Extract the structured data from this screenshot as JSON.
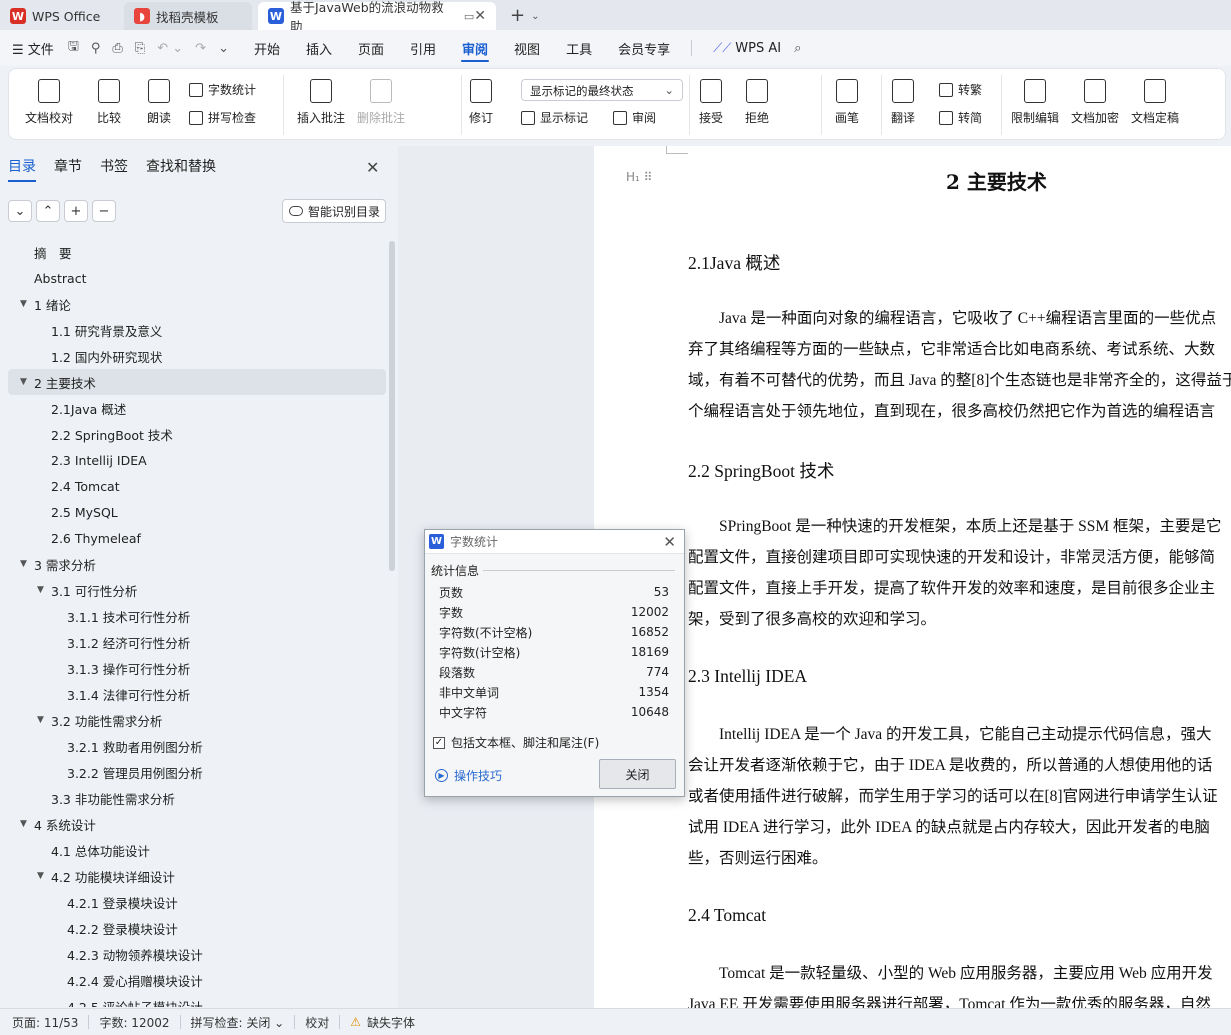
{
  "tabs": {
    "wps": "WPS Office",
    "template": "找稻壳模板",
    "doc": "基于JavaWeb的流浪动物救助"
  },
  "menu": {
    "file": "文件",
    "tabs": [
      "开始",
      "插入",
      "页面",
      "引用",
      "审阅",
      "视图",
      "工具",
      "会员专享"
    ],
    "active": "审阅",
    "ai": "WPS AI"
  },
  "ribbon": {
    "doc_check": "文档校对",
    "compare": "比较",
    "read": "朗读",
    "word_count": "字数统计",
    "spell_check": "拼写检查",
    "insert_comment": "插入批注",
    "delete_comment": "删除批注",
    "revise": "修订",
    "markup_state": "显示标记的最终状态",
    "show_markup": "显示标记",
    "review_pane": "审阅",
    "accept": "接受",
    "reject": "拒绝",
    "pen": "画笔",
    "translate": "翻译",
    "to_traditional": "转繁",
    "to_simplified": "转简",
    "restrict_edit": "限制编辑",
    "encrypt": "文档加密",
    "finalize": "文档定稿"
  },
  "nav": {
    "tabs": [
      "目录",
      "章节",
      "书签",
      "查找和替换"
    ],
    "smart_toc": "智能识别目录",
    "toc": [
      {
        "label": "摘　要",
        "level": 0,
        "caret": false
      },
      {
        "label": "Abstract",
        "level": 0,
        "caret": false
      },
      {
        "label": "1  绪论",
        "level": 0,
        "caret": true
      },
      {
        "label": "1.1 研究背景及意义",
        "level": 1,
        "caret": false
      },
      {
        "label": "1.2 国内外研究现状",
        "level": 1,
        "caret": false
      },
      {
        "label": "2  主要技术",
        "level": 0,
        "caret": true,
        "selected": true
      },
      {
        "label": "2.1Java 概述",
        "level": 1,
        "caret": false
      },
      {
        "label": "2.2 SpringBoot 技术",
        "level": 1,
        "caret": false
      },
      {
        "label": "2.3 Intellij IDEA",
        "level": 1,
        "caret": false
      },
      {
        "label": "2.4 Tomcat",
        "level": 1,
        "caret": false
      },
      {
        "label": "2.5 MySQL",
        "level": 1,
        "caret": false
      },
      {
        "label": "2.6 Thymeleaf",
        "level": 1,
        "caret": false
      },
      {
        "label": "3  需求分析",
        "level": 0,
        "caret": true
      },
      {
        "label": "3.1 可行性分析",
        "level": 1,
        "caret": true
      },
      {
        "label": "3.1.1  技术可行性分析",
        "level": 2,
        "caret": false
      },
      {
        "label": "3.1.2  经济可行性分析",
        "level": 2,
        "caret": false
      },
      {
        "label": "3.1.3  操作可行性分析",
        "level": 2,
        "caret": false
      },
      {
        "label": "3.1.4  法律可行性分析",
        "level": 2,
        "caret": false
      },
      {
        "label": "3.2  功能性需求分析",
        "level": 1,
        "caret": true
      },
      {
        "label": "3.2.1 救助者用例图分析",
        "level": 2,
        "caret": false
      },
      {
        "label": "3.2.2  管理员用例图分析",
        "level": 2,
        "caret": false
      },
      {
        "label": "3.3  非功能性需求分析",
        "level": 1,
        "caret": false
      },
      {
        "label": "4  系统设计",
        "level": 0,
        "caret": true
      },
      {
        "label": "4.1  总体功能设计",
        "level": 1,
        "caret": false
      },
      {
        "label": "4.2  功能模块详细设计",
        "level": 1,
        "caret": true
      },
      {
        "label": "4.2.1  登录模块设计",
        "level": 2,
        "caret": false
      },
      {
        "label": "4.2.2  登录模块设计",
        "level": 2,
        "caret": false
      },
      {
        "label": "4.2.3  动物领养模块设计",
        "level": 2,
        "caret": false
      },
      {
        "label": "4.2.4 爱心捐赠模块设计",
        "level": 2,
        "caret": false
      },
      {
        "label": "4.2.5  评论帖子模块设计",
        "level": 2,
        "caret": false
      }
    ]
  },
  "document": {
    "heading": "2  主要技术",
    "sections": [
      {
        "title": "2.1Java 概述",
        "lines": [
          "　　Java 是一种面向对象的编程语言，它吸收了 C++编程语言里面的一些优点",
          "弃了其络编程等方面的一些缺点，它非常适合比如电商系统、考试系统、大数",
          "域，有着不可替代的优势，而且 Java 的整[8]个生态链也是非常齐全的，这得益于",
          "个编程语言处于领先地位，直到现在，很多高校仍然把它作为首选的编程语言"
        ]
      },
      {
        "title": "2.2 SpringBoot 技术",
        "lines": [
          "　　SPringBoot 是一种快速的开发框架，本质上还是基于 SSM 框架，主要是它",
          "配置文件，直接创建项目即可实现快速的开发和设计，非常灵活方便，能够简",
          "配置文件，直接上手开发，提高了软件开发的效率和速度，是目前很多企业主",
          "架，受到了很多高校的欢迎和学习。"
        ]
      },
      {
        "title": "2.3 Intellij IDEA",
        "lines": [
          "　　Intellij IDEA 是一个 Java 的开发工具，它能自己主动提示代码信息，强大",
          "会让开发者逐渐依赖于它，由于 IDEA 是收费的，所以普通的人想使用他的话",
          "或者使用插件进行破解，而学生用于学习的话可以在[8]官网进行申请学生认证",
          "试用 IDEA 进行学习，此外 IDEA 的缺点就是占内存较大，因此开发者的电脑",
          "些，否则运行困难。"
        ]
      },
      {
        "title": "2.4 Tomcat",
        "lines": [
          "　　Tomcat 是一款轻量级、小型的 Web 应用服务器，主要应用 Web 应用开发",
          "Java EE 开发需要使用服务器进行部署，Tomcat 作为一款优秀的服务器，自然"
        ]
      }
    ]
  },
  "dialog": {
    "title": "字数统计",
    "group": "统计信息",
    "rows": [
      {
        "label": "页数",
        "value": "53"
      },
      {
        "label": "字数",
        "value": "12002"
      },
      {
        "label": "字符数(不计空格)",
        "value": "16852"
      },
      {
        "label": "字符数(计空格)",
        "value": "18169"
      },
      {
        "label": "段落数",
        "value": "774"
      },
      {
        "label": "非中文单词",
        "value": "1354"
      },
      {
        "label": "中文字符",
        "value": "10648"
      }
    ],
    "checkbox": "包括文本框、脚注和尾注(F)",
    "tips": "操作技巧",
    "close": "关闭"
  },
  "status": {
    "page": "页面: 11/53",
    "words": "字数: 12002",
    "spell": "拼写检查: 关闭",
    "proof": "校对",
    "missing_font": "缺失字体"
  }
}
